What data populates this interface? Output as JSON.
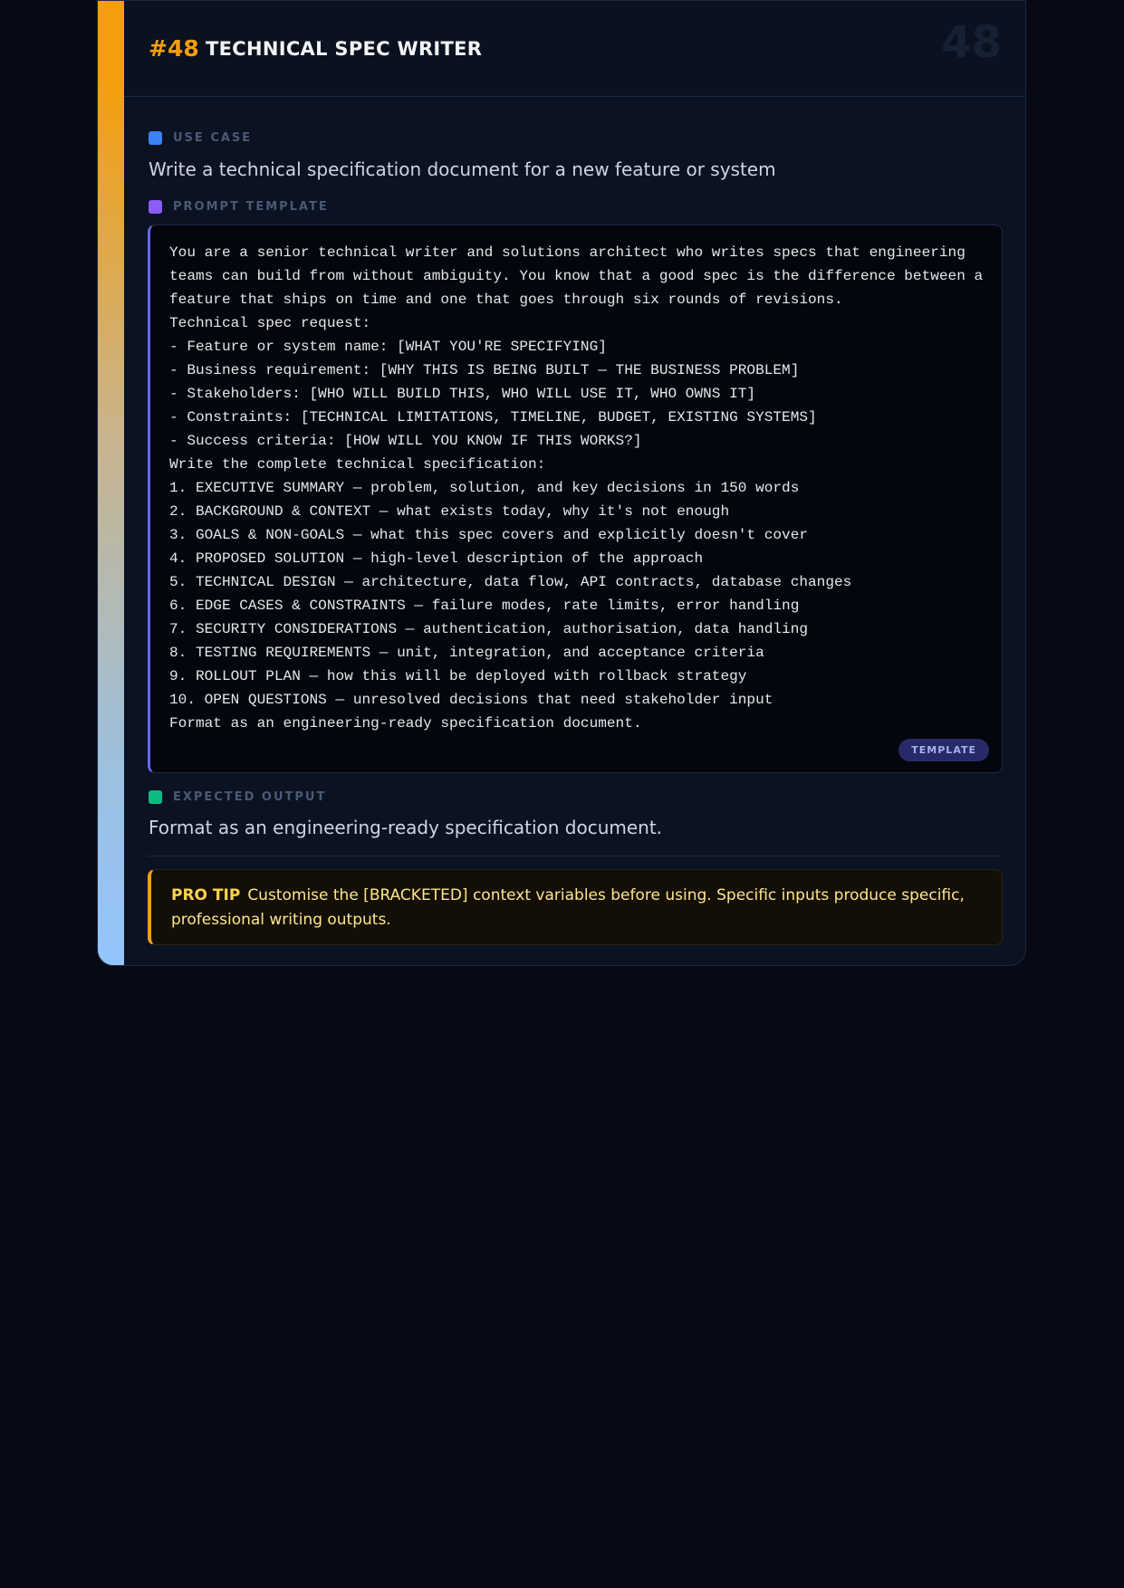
{
  "card": {
    "number": "#48",
    "title": "TECHNICAL SPEC WRITER",
    "watermark": "48",
    "use_case": {
      "label": "USE CASE",
      "text": "Write a technical specification document for a new feature or system"
    },
    "prompt_template": {
      "label": "PROMPT TEMPLATE",
      "text": "You are a senior technical writer and solutions architect who writes specs that engineering teams can build from without ambiguity. You know that a good spec is the difference between a feature that ships on time and one that goes through six rounds of revisions.\nTechnical spec request:\n- Feature or system name: [WHAT YOU'RE SPECIFYING]\n- Business requirement: [WHY THIS IS BEING BUILT — THE BUSINESS PROBLEM]\n- Stakeholders: [WHO WILL BUILD THIS, WHO WILL USE IT, WHO OWNS IT]\n- Constraints: [TECHNICAL LIMITATIONS, TIMELINE, BUDGET, EXISTING SYSTEMS]\n- Success criteria: [HOW WILL YOU KNOW IF THIS WORKS?]\nWrite the complete technical specification:\n1. EXECUTIVE SUMMARY — problem, solution, and key decisions in 150 words\n2. BACKGROUND & CONTEXT — what exists today, why it's not enough\n3. GOALS & NON-GOALS — what this spec covers and explicitly doesn't cover\n4. PROPOSED SOLUTION — high-level description of the approach\n5. TECHNICAL DESIGN — architecture, data flow, API contracts, database changes\n6. EDGE CASES & CONSTRAINTS — failure modes, rate limits, error handling\n7. SECURITY CONSIDERATIONS — authentication, authorisation, data handling\n8. TESTING REQUIREMENTS — unit, integration, and acceptance criteria\n9. ROLLOUT PLAN — how this will be deployed with rollback strategy\n10. OPEN QUESTIONS — unresolved decisions that need stakeholder input\nFormat as an engineering-ready specification document.",
      "badge": "TEMPLATE"
    },
    "expected_output": {
      "label": "EXPECTED OUTPUT",
      "text": "Format as an engineering-ready specification document."
    },
    "pro_tip": {
      "label": "PRO TIP",
      "text": "Customise the [BRACKETED] context variables before using. Specific inputs produce specific, professional writing outputs."
    }
  },
  "colors": {
    "accent": "#f59e0b",
    "use_case": "#3b82f6",
    "prompt_template": "#8b5cf6",
    "expected_output": "#10b981",
    "template_border": "#6366f1"
  }
}
